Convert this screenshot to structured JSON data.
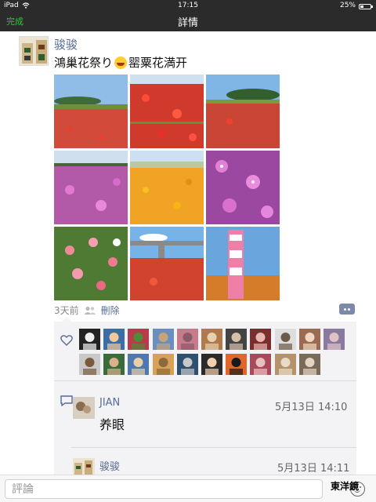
{
  "statusbar": {
    "device": "iPad",
    "time": "17:15",
    "battery": "25%",
    "battery_level": 0.25
  },
  "navbar": {
    "done": "完成",
    "title": "詳情"
  },
  "post": {
    "author": "骏骏",
    "text": "鴻巢花祭り",
    "text_after_emoji": "罂粟花満开",
    "time": "3天前",
    "delete_label": "刪除"
  },
  "comments": [
    {
      "name": "JIAN",
      "time": "5月13日 14:10",
      "text": "养眼"
    },
    {
      "name": "骏骏",
      "time": "5月13日 14:11",
      "text": ""
    }
  ],
  "input": {
    "placeholder": "評論"
  },
  "watermark": "東洋鏡",
  "colors": {
    "bar": "#2b2b2b",
    "done_green": "#39c43a",
    "link_blue": "#576b95",
    "panel_bg": "#f3f3f5"
  },
  "icons": [
    "wifi-icon",
    "heart-icon",
    "comment-icon",
    "emoji-icon",
    "people-icon"
  ]
}
